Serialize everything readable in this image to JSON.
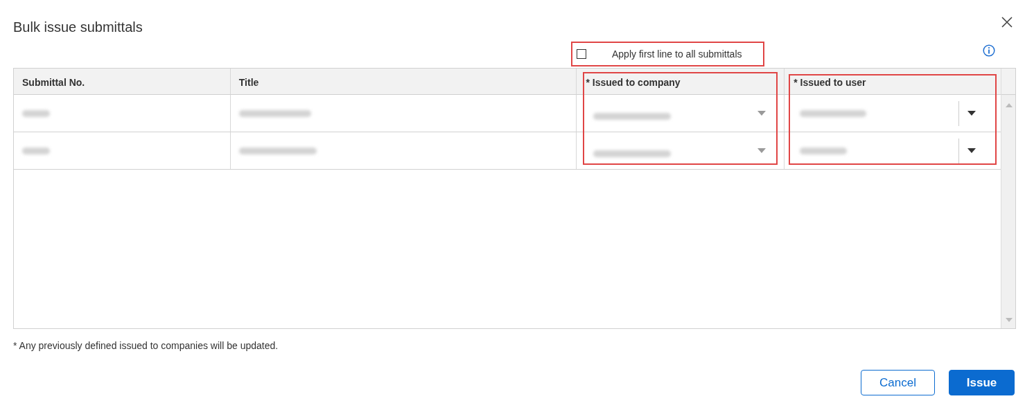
{
  "dialog": {
    "title": "Bulk issue submittals"
  },
  "apply_all": {
    "label": "Apply first line to all submittals",
    "checked": false,
    "highlighted": true
  },
  "table": {
    "columns": [
      {
        "label": "Submittal No.",
        "kind": "text"
      },
      {
        "label": "Title",
        "kind": "text"
      },
      {
        "label": "* Issued to company",
        "kind": "select",
        "highlighted": true
      },
      {
        "label": "* Issued to user",
        "kind": "combo",
        "highlighted": true
      }
    ],
    "rows": [
      {
        "redacted": true
      },
      {
        "redacted": true
      }
    ]
  },
  "footnote": "* Any previously defined issued to companies will be updated.",
  "buttons": [
    {
      "label": "Cancel",
      "kind": "secondary"
    },
    {
      "label": "Issue",
      "kind": "primary"
    }
  ]
}
